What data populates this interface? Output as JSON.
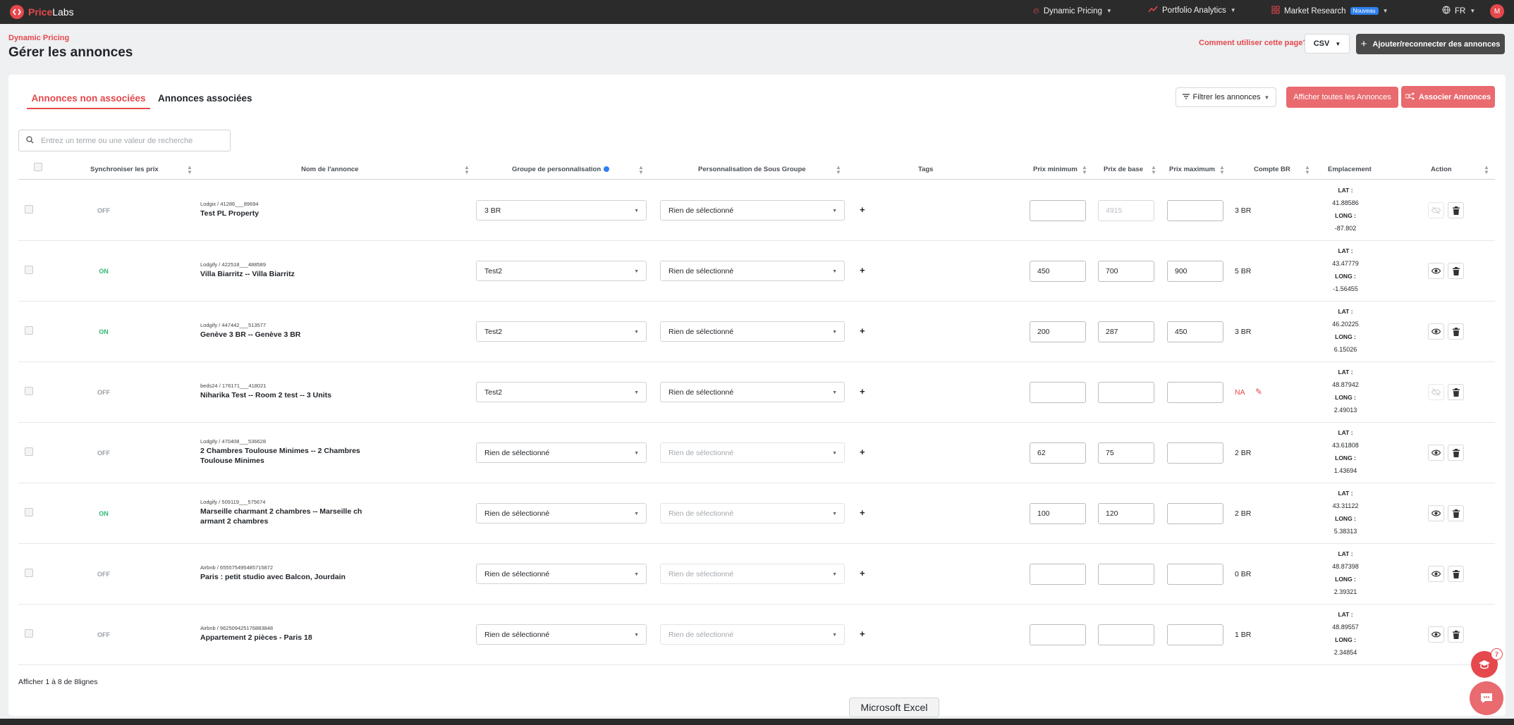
{
  "brand": {
    "name_a": "Price",
    "name_b": "Labs"
  },
  "nav": {
    "dynamic_pricing": "Dynamic Pricing",
    "portfolio_analytics": "Portfolio Analytics",
    "market_research": "Market Research",
    "new_badge": "Nouveau",
    "language": "FR",
    "avatar_initial": "M"
  },
  "header": {
    "breadcrumb": "Dynamic Pricing",
    "title": "Gérer les annonces",
    "help_link": "Comment utiliser cette page?",
    "csv_label": "CSV",
    "add_label": "Ajouter/reconnecter des annonces"
  },
  "tabs": {
    "unlinked": "Annonces non associées",
    "linked": "Annonces associées"
  },
  "toolbar": {
    "filter_label": "Filtrer les annonces",
    "show_all_label": "Afficher toutes les Annonces",
    "associate_label": "Associer Annonces"
  },
  "search": {
    "placeholder": "Entrez un terme ou une valeur de recherche"
  },
  "columns": {
    "sync": "Synchroniser les prix",
    "name": "Nom de l'annonce",
    "group": "Groupe de personnalisation",
    "subgroup": "Personnalisation de Sous Groupe",
    "tags": "Tags",
    "min": "Prix minimum",
    "base": "Prix de base",
    "max": "Prix maximum",
    "br": "Compte BR",
    "location": "Emplacement",
    "action": "Action"
  },
  "labels": {
    "lat": "LAT :",
    "long": "LONG :",
    "add_tag": "+"
  },
  "rows": [
    {
      "sync": "OFF",
      "source": "Lodgix / 41286___89694",
      "name": "Test PL Property",
      "group": "3 BR",
      "subgroup": "Rien de sélectionné",
      "min": "",
      "base": "4915",
      "max": "",
      "br": "3 BR",
      "lat": "41.88586",
      "long": "-87.802"
    },
    {
      "sync": "ON",
      "source": "Lodgify / 422518___488589",
      "name": "Villa Biarritz -- Villa Biarritz",
      "group": "Test2",
      "subgroup": "Rien de sélectionné",
      "min": "450",
      "base": "700",
      "max": "900",
      "br": "5 BR",
      "lat": "43.47779",
      "long": "-1.56455"
    },
    {
      "sync": "ON",
      "source": "Lodgify / 447442___513577",
      "name": "Genève 3 BR -- Genève 3 BR",
      "group": "Test2",
      "subgroup": "Rien de sélectionné",
      "min": "200",
      "base": "287",
      "max": "450",
      "br": "3 BR",
      "lat": "46.20225",
      "long": "6.15026"
    },
    {
      "sync": "OFF",
      "source": "beds24 / 176171___418021",
      "name": "Niharika Test -- Room 2 test -- 3 Units",
      "group": "Test2",
      "subgroup": "Rien de sélectionné",
      "min": "",
      "base": "",
      "max": "",
      "br": "NA",
      "lat": "48.87942",
      "long": "2.49013"
    },
    {
      "sync": "OFF",
      "source": "Lodgify / 470408___536628",
      "name": "2 Chambres Toulouse Minimes -- 2 Chambres Toulouse Minimes",
      "group": "Rien de sélectionné",
      "subgroup": "Rien de sélectionné",
      "min": "62",
      "base": "75",
      "max": "",
      "br": "2 BR",
      "lat": "43.61808",
      "long": "1.43694"
    },
    {
      "sync": "ON",
      "source": "Lodgify / 509119___575674",
      "name": "Marseille charmant 2 chambres -- Marseille ch armant 2 chambres",
      "group": "Rien de sélectionné",
      "subgroup": "Rien de sélectionné",
      "min": "100",
      "base": "120",
      "max": "",
      "br": "2 BR",
      "lat": "43.31122",
      "long": "5.38313"
    },
    {
      "sync": "OFF",
      "source": "Airbnb / 655575495485715872",
      "name": "Paris : petit studio avec Balcon, Jourdain",
      "group": "Rien de sélectionné",
      "subgroup": "Rien de sélectionné",
      "min": "",
      "base": "",
      "max": "",
      "br": "0 BR",
      "lat": "48.87398",
      "long": "2.39321"
    },
    {
      "sync": "OFF",
      "source": "Airbnb / 962509425176883848",
      "name": "Appartement 2 pièces - Paris 18",
      "group": "Rien de sélectionné",
      "subgroup": "Rien de sélectionné",
      "min": "",
      "base": "",
      "max": "",
      "br": "1 BR",
      "lat": "48.89557",
      "long": "2.34854"
    }
  ],
  "footer": {
    "count_text": "Afficher 1 à 8 de 8lignes"
  },
  "floating": {
    "excel_tooltip": "Microsoft Excel",
    "help_count": "7"
  },
  "colors": {
    "brand": "#e5484d",
    "on": "#2fb872",
    "dark": "#2b2b2b"
  }
}
